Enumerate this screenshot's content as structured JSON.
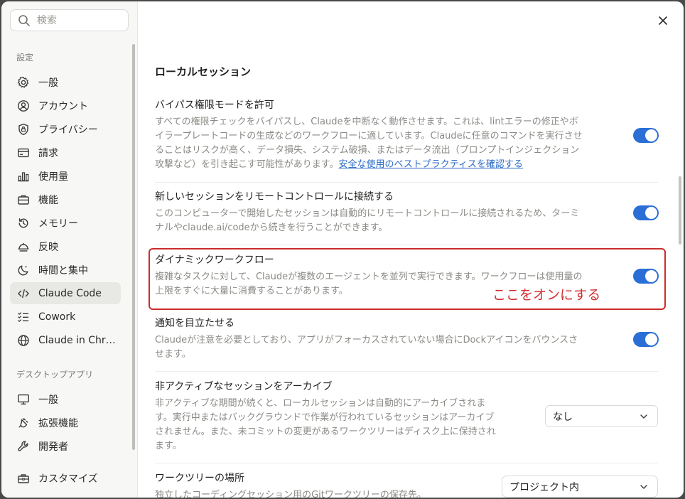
{
  "search": {
    "placeholder": "検索"
  },
  "sidebar": {
    "section_settings": "設定",
    "items": [
      {
        "label": "一般",
        "icon": "gear-icon"
      },
      {
        "label": "アカウント",
        "icon": "user-circle-icon"
      },
      {
        "label": "プライバシー",
        "icon": "shield-lock-icon"
      },
      {
        "label": "請求",
        "icon": "credit-card-icon"
      },
      {
        "label": "使用量",
        "icon": "bar-chart-icon"
      },
      {
        "label": "機能",
        "icon": "briefcase-icon"
      },
      {
        "label": "メモリー",
        "icon": "history-icon"
      },
      {
        "label": "反映",
        "icon": "dome-icon"
      },
      {
        "label": "時間と集中",
        "icon": "moon-icon"
      },
      {
        "label": "Claude Code",
        "icon": "code-icon",
        "active": true
      },
      {
        "label": "Cowork",
        "icon": "checklist-icon"
      },
      {
        "label": "Claude in Chr…",
        "icon": "globe-icon"
      }
    ],
    "section_desktop": "デスクトップアプリ",
    "desktop_items": [
      {
        "label": "一般",
        "icon": "monitor-icon"
      },
      {
        "label": "拡張機能",
        "icon": "plug-icon"
      },
      {
        "label": "開発者",
        "icon": "wrench-icon"
      }
    ],
    "bottom_item": {
      "label": "カスタマイズ",
      "icon": "toolbox-icon"
    }
  },
  "main": {
    "title": "ローカルセッション",
    "settings": [
      {
        "title": "バイパス権限モードを許可",
        "desc_lines": [
          "すべての権限チェックをバイパスし、Claudeを中断なく動作させます。これは、lintエラーの修正やボ",
          "イラープレートコードの生成などのワークフローに適しています。Claudeに任意のコマンドを実行させ",
          "ることはリスクが高く、データ損失、システム破損、またはデータ流出（プロンプトインジェクション"
        ],
        "desc_last": "攻撃など）を引き起こす可能性があります。",
        "link": "安全な使用のベストプラクティスを確認する",
        "enabled": true
      },
      {
        "title": "新しいセッションをリモートコントロールに接続する",
        "desc_lines": [
          "このコンピューターで開始したセッションは自動的にリモートコントロールに接続されるため、ターミ",
          "ナルやclaude.ai/codeから続きを行うことができます。"
        ],
        "enabled": true
      },
      {
        "title": "ダイナミックワークフロー",
        "desc_lines": [
          "複雑なタスクに対して、Claudeが複数のエージェントを並列で実行できます。ワークフローは使用量の",
          "上限をすぐに大量に消費することがあります。"
        ],
        "enabled": true
      },
      {
        "title": "通知を目立たせる",
        "desc_lines": [
          "Claudeが注意を必要としており、アプリがフォーカスされていない場合にDockアイコンをバウンスさ",
          "せます。"
        ],
        "enabled": true
      },
      {
        "title": "非アクティブなセッションをアーカイブ",
        "desc_lines": [
          "非アクティブな期間が続くと、ローカルセッションは自動的にアーカイブされま",
          "す。実行中またはバックグラウンドで作業が行われているセッションはアーカイブ",
          "されません。また、未コミットの変更があるワークツリーはディスク上に保持され",
          "ます。"
        ],
        "select_value": "なし"
      },
      {
        "title": "ワークツリーの場所",
        "desc_lines": [
          "独立したコーディングセッション用のGitワークツリーの保存先。"
        ],
        "select_value": "プロジェクト内"
      }
    ],
    "annotation": "ここをオンにする"
  },
  "colors": {
    "accent": "#2b6fd6",
    "highlight": "#cc2b2b",
    "annotation": "#d22e2e"
  }
}
